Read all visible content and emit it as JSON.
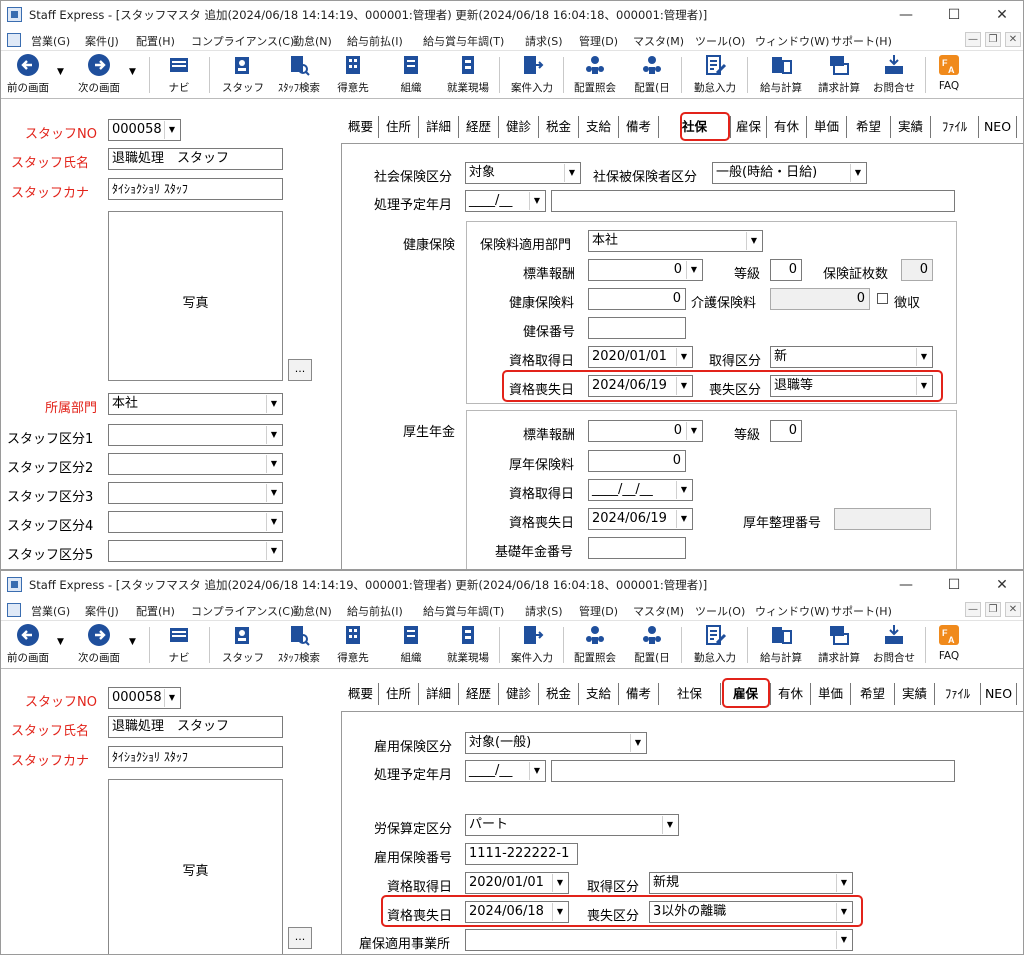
{
  "windows": [
    {
      "title": "Staff Express - [スタッフマスタ 追加(2024/06/18 14:14:19、000001:管理者) 更新(2024/06/18 16:04:18、000001:管理者)]",
      "window_controls": [
        "—",
        "☐",
        "✕"
      ],
      "menu": [
        "営業(G)",
        "案件(J)",
        "配置(H)",
        "コンプライアンス(C)",
        "勤怠(N)",
        "給与前払(I)",
        "給与賞与年調(T)",
        "請求(S)",
        "管理(D)",
        "マスタ(M)",
        "ツール(O)",
        "ウィンドウ(W)",
        "サポート(H)"
      ],
      "mdi_controls": [
        "—",
        "❐",
        "✕"
      ],
      "toolbar": [
        "前の画面",
        "次の画面",
        "ナビ",
        "スタッフ",
        "ｽﾀｯﾌ検索",
        "得意先",
        "組織",
        "就業現場",
        "案件入力",
        "配置照会",
        "配置(日",
        "勤怠入力",
        "給与計算",
        "請求計算",
        "お問合せ",
        "FAQ"
      ],
      "left": {
        "staff_no_label": "スタッフNO",
        "staff_no": "000058",
        "staff_name_label": "スタッフ氏名",
        "staff_name": "退職処理　スタッフ",
        "staff_kana_label": "スタッフカナ",
        "staff_kana": "ﾀｲｼｮｸｼｮﾘ ｽﾀｯﾌ",
        "photo_label": "写真",
        "photo_button": "...",
        "dept_label": "所属部門",
        "dept": "本社",
        "categories": [
          "スタッフ区分1",
          "スタッフ区分2",
          "スタッフ区分3",
          "スタッフ区分4",
          "スタッフ区分5"
        ]
      },
      "tabs": [
        "概要",
        "住所",
        "詳細",
        "経歴",
        "健診",
        "税金",
        "支給",
        "備考",
        "社保",
        "雇保",
        "有休",
        "単価",
        "希望",
        "実績",
        "ﾌｧｲﾙ",
        "NEO"
      ],
      "active_tab": "社保",
      "shaho": {
        "ins_class_label": "社会保険区分",
        "ins_class": "対象",
        "insured_class_label": "社保被保険者区分",
        "insured_class": "一般(時給・日給)",
        "plan_month_label": "処理予定年月",
        "plan_month": "____/__",
        "health_label": "健康保険",
        "health_dept_label": "保険料適用部門",
        "health_dept": "本社",
        "std_pay_label": "標準報酬",
        "std_pay": "0",
        "grade_label": "等級",
        "grade": "0",
        "card_count_label": "保険証枚数",
        "card_count": "0",
        "health_fee_label": "健康保険料",
        "health_fee": "0",
        "care_fee_label": "介護保険料",
        "care_fee": "0",
        "collect_label": "徴収",
        "health_no_label": "健保番号",
        "health_no": "",
        "acquire_date_label": "資格取得日",
        "acquire_date": "2020/01/01",
        "acquire_class_label": "取得区分",
        "acquire_class": "新",
        "loss_date_label": "資格喪失日",
        "loss_date": "2024/06/19",
        "loss_class_label": "喪失区分",
        "loss_class": "退職等",
        "pension_label": "厚生年金",
        "p_std_pay_label": "標準報酬",
        "p_std_pay": "0",
        "p_grade_label": "等級",
        "p_grade": "0",
        "p_fee_label": "厚年保険料",
        "p_fee": "0",
        "p_acquire_label": "資格取得日",
        "p_acquire": "____/__/__",
        "p_loss_label": "資格喪失日",
        "p_loss": "2024/06/19",
        "p_arrange_label": "厚年整理番号",
        "p_arrange": "",
        "basic_no_label": "基礎年金番号",
        "basic_no": ""
      }
    },
    {
      "title": "Staff Express - [スタッフマスタ 追加(2024/06/18 14:14:19、000001:管理者) 更新(2024/06/18 16:04:18、000001:管理者)]",
      "active_tab": "雇保",
      "koho": {
        "emp_class_label": "雇用保険区分",
        "emp_class": "対象(一般)",
        "plan_month_label": "処理予定年月",
        "plan_month": "____/__",
        "labor_class_label": "労保算定区分",
        "labor_class": "パート",
        "emp_no_label": "雇用保険番号",
        "emp_no": "1111-222222-1",
        "acquire_date_label": "資格取得日",
        "acquire_date": "2020/01/01",
        "acquire_class_label": "取得区分",
        "acquire_class": "新規",
        "loss_date_label": "資格喪失日",
        "loss_date": "2024/06/18",
        "loss_class_label": "喪失区分",
        "loss_class": "3以外の離職",
        "office_label": "雇保適用事業所",
        "office": ""
      }
    }
  ],
  "colors": {
    "required_label": "#e2231a",
    "highlight": "#e2231a",
    "icon_blue": "#1f4f9c"
  }
}
